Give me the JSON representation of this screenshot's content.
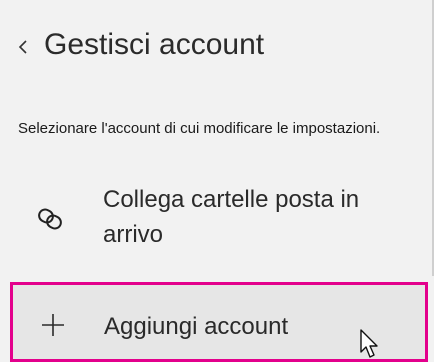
{
  "header": {
    "title": "Gestisci account"
  },
  "description": "Selezionare l'account di cui modificare le impostazioni.",
  "link_inboxes": {
    "label": "Collega cartelle posta in arrivo"
  },
  "add_account": {
    "label": "Aggiungi account"
  },
  "icons": {
    "back": "chevron-left-icon",
    "link": "link-icon",
    "add": "plus-icon",
    "cursor": "mouse-pointer-icon"
  },
  "colors": {
    "highlight_border": "#e3008c",
    "background": "#f2f2f2",
    "selected_background": "#e6e6e6"
  }
}
